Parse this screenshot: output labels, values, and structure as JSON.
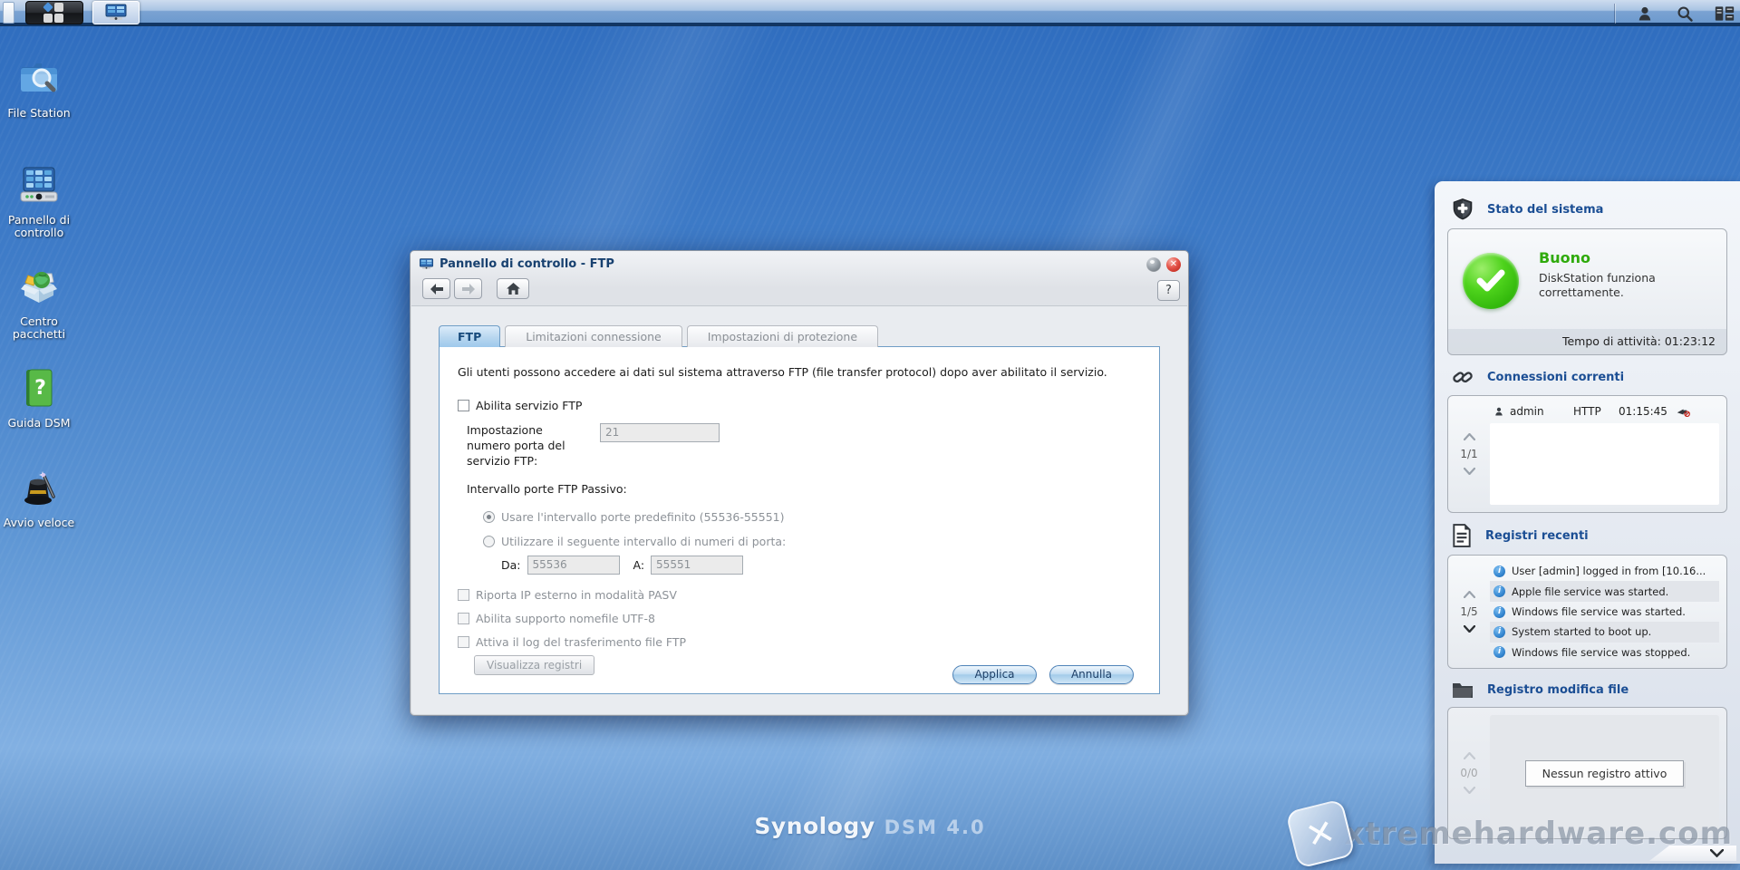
{
  "colors": {
    "status_ok_green": "#2faa0b",
    "widget_header_blue": "#1b4e94",
    "title_blue": "#17406f",
    "info_icon_blue": "#3a8bd4",
    "close_red": "#c6241c"
  },
  "taskbar": {
    "icons": [
      "show-desktop",
      "main-menu",
      "control-panel-app",
      "user",
      "search",
      "widgets"
    ]
  },
  "desktop": {
    "icons": [
      {
        "label": "File Station"
      },
      {
        "label": "Pannello di controllo"
      },
      {
        "label": "Centro pacchetti"
      },
      {
        "label": "Guida DSM"
      },
      {
        "label": "Avvio veloce"
      }
    ],
    "logo_brand": "Synology",
    "logo_version": "DSM 4.0"
  },
  "window": {
    "title": "Pannello di controllo - FTP",
    "help_label": "?",
    "close_glyph": "✕",
    "tabs": [
      {
        "label": "FTP",
        "active": true
      },
      {
        "label": "Limitazioni connessione",
        "active": false
      },
      {
        "label": "Impostazioni di protezione",
        "active": false
      }
    ],
    "ftp": {
      "description": "Gli utenti possono accedere ai dati sul sistema attraverso FTP (file transfer protocol) dopo aver abilitato il servizio.",
      "enable_label": "Abilita servizio FTP",
      "port_label": "Impostazione numero porta del servizio FTP:",
      "port_value": "21",
      "passive_label": "Intervallo porte FTP Passivo:",
      "radio_default_label": "Usare l'intervallo porte predefinito (55536-55551)",
      "radio_custom_label": "Utilizzare il seguente intervallo di numeri di porta:",
      "from_label": "Da:",
      "from_value": "55536",
      "to_label": "A:",
      "to_value": "55551",
      "check_pasv_label": "Riporta IP esterno in modalità PASV",
      "check_utf8_label": "Abilita supporto nomefile UTF-8",
      "check_ftplog_label": "Attiva il log del trasferimento file FTP",
      "view_logs_button": "Visualizza registri",
      "apply_button": "Applica",
      "cancel_button": "Annulla"
    }
  },
  "widget": {
    "system_status": {
      "title": "Stato del sistema",
      "status": "Buono",
      "description": "DiskStation funziona correttamente.",
      "uptime": "Tempo di attività: 01:23:12"
    },
    "connections": {
      "title": "Connessioni correnti",
      "page": "1/1",
      "row": {
        "user": "admin",
        "protocol": "HTTP",
        "time": "01:15:45"
      }
    },
    "logs": {
      "title": "Registri recenti",
      "page": "1/5",
      "entries": [
        "User [admin] logged in from [10.16...",
        "Apple file service was started.",
        "Windows file service was started.",
        "System started to boot up.",
        "Windows file service was stopped."
      ]
    },
    "file_log": {
      "title": "Registro modifica file",
      "page": "0/0",
      "empty_label": "Nessun registro attivo"
    }
  },
  "watermark": {
    "text": "xtremehardware.com",
    "logo_glyph": "✕"
  }
}
